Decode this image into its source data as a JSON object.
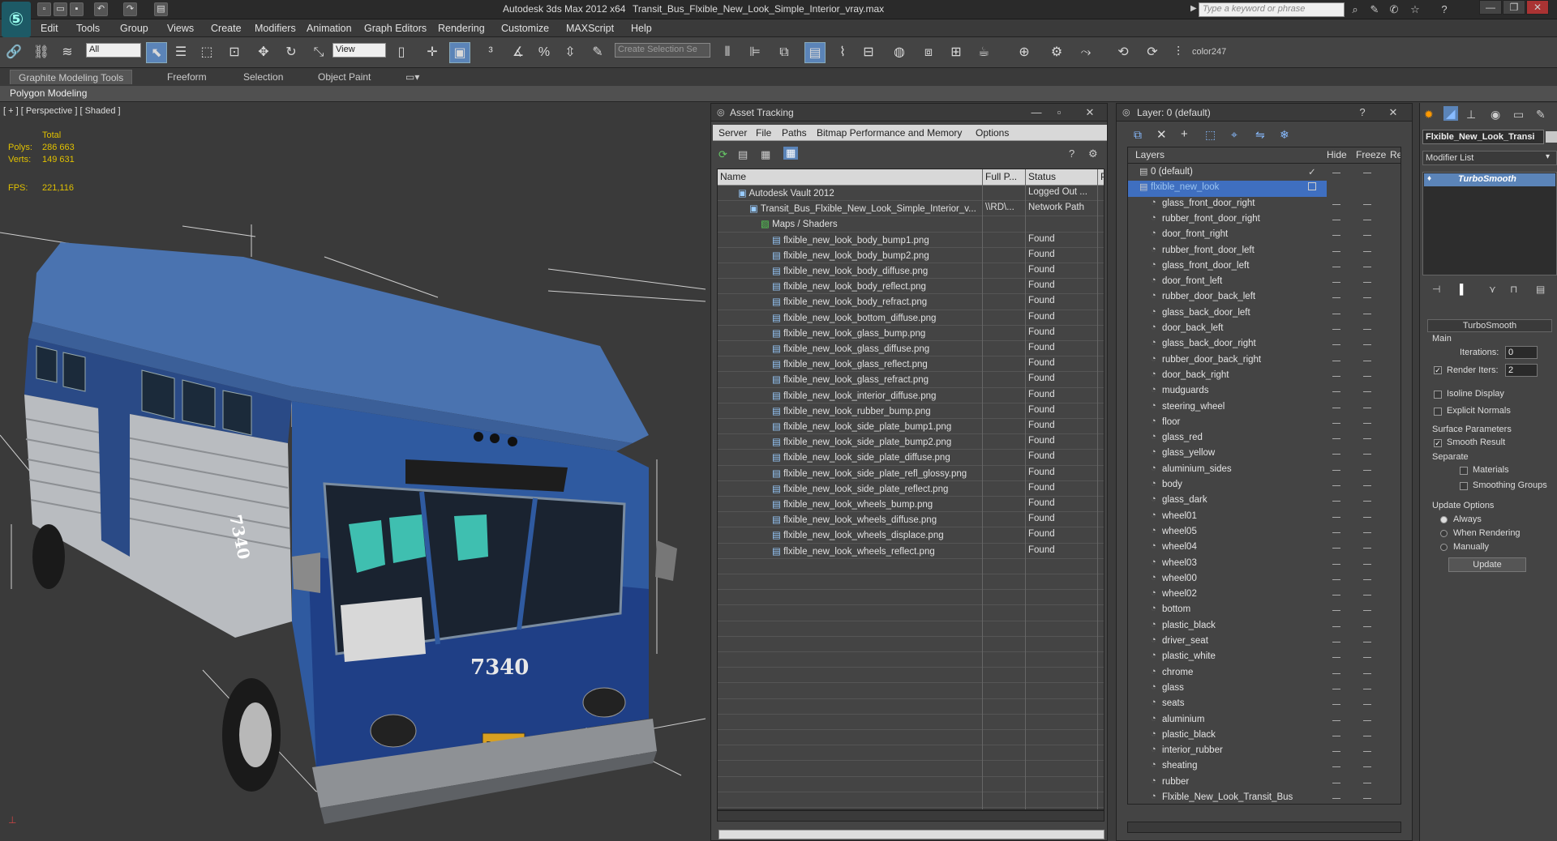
{
  "window": {
    "app_title": "Autodesk 3ds Max  2012 x64",
    "doc_title": "Transit_Bus_Flxible_New_Look_Simple_Interior_vray.max",
    "search_placeholder": "Type a keyword or phrase"
  },
  "menu": [
    "Edit",
    "Tools",
    "Group",
    "Views",
    "Create",
    "Modifiers",
    "Animation",
    "Graph Editors",
    "Rendering",
    "Customize",
    "MAXScript",
    "Help"
  ],
  "toolbar": {
    "selection_filter": "All",
    "ref_coord": "View",
    "named_selection": "Create Selection Se",
    "color_label": "color247"
  },
  "ribbon": {
    "tabs": [
      "Graphite Modeling Tools",
      "Freeform",
      "Selection",
      "Object Paint"
    ],
    "sub": "Polygon Modeling"
  },
  "viewport": {
    "label": "[ + ] [ Perspective ] [ Shaded ]",
    "total_label": "Total",
    "polys_label": "Polys:",
    "polys_value": "286 663",
    "verts_label": "Verts:",
    "verts_value": "149 631",
    "fps_label": "FPS:",
    "fps_value": "221,116",
    "bus_number": "7340",
    "plate": "BL-1590"
  },
  "asset_tracking": {
    "title": "Asset Tracking",
    "menu": [
      "Server",
      "File",
      "Paths",
      "Bitmap Performance and Memory",
      "Options"
    ],
    "columns": [
      "Name",
      "Full P...",
      "Status",
      "P"
    ],
    "rows": [
      {
        "name": "Autodesk Vault 2012",
        "path": "",
        "status": "Logged Out ...",
        "indent": 0
      },
      {
        "name": "Transit_Bus_Flxible_New_Look_Simple_Interior_v...",
        "path": "\\\\RD\\...",
        "status": "Network Path",
        "indent": 1
      },
      {
        "name": "Maps / Shaders",
        "path": "",
        "status": "",
        "indent": 2
      },
      {
        "name": "flxible_new_look_body_bump1.png",
        "path": "",
        "status": "Found",
        "indent": 3
      },
      {
        "name": "flxible_new_look_body_bump2.png",
        "path": "",
        "status": "Found",
        "indent": 3
      },
      {
        "name": "flxible_new_look_body_diffuse.png",
        "path": "",
        "status": "Found",
        "indent": 3
      },
      {
        "name": "flxible_new_look_body_reflect.png",
        "path": "",
        "status": "Found",
        "indent": 3
      },
      {
        "name": "flxible_new_look_body_refract.png",
        "path": "",
        "status": "Found",
        "indent": 3
      },
      {
        "name": "flxible_new_look_bottom_diffuse.png",
        "path": "",
        "status": "Found",
        "indent": 3
      },
      {
        "name": "flxible_new_look_glass_bump.png",
        "path": "",
        "status": "Found",
        "indent": 3
      },
      {
        "name": "flxible_new_look_glass_diffuse.png",
        "path": "",
        "status": "Found",
        "indent": 3
      },
      {
        "name": "flxible_new_look_glass_reflect.png",
        "path": "",
        "status": "Found",
        "indent": 3
      },
      {
        "name": "flxible_new_look_glass_refract.png",
        "path": "",
        "status": "Found",
        "indent": 3
      },
      {
        "name": "flxible_new_look_interior_diffuse.png",
        "path": "",
        "status": "Found",
        "indent": 3
      },
      {
        "name": "flxible_new_look_rubber_bump.png",
        "path": "",
        "status": "Found",
        "indent": 3
      },
      {
        "name": "flxible_new_look_side_plate_bump1.png",
        "path": "",
        "status": "Found",
        "indent": 3
      },
      {
        "name": "flxible_new_look_side_plate_bump2.png",
        "path": "",
        "status": "Found",
        "indent": 3
      },
      {
        "name": "flxible_new_look_side_plate_diffuse.png",
        "path": "",
        "status": "Found",
        "indent": 3
      },
      {
        "name": "flxible_new_look_side_plate_refl_glossy.png",
        "path": "",
        "status": "Found",
        "indent": 3
      },
      {
        "name": "flxible_new_look_side_plate_reflect.png",
        "path": "",
        "status": "Found",
        "indent": 3
      },
      {
        "name": "flxible_new_look_wheels_bump.png",
        "path": "",
        "status": "Found",
        "indent": 3
      },
      {
        "name": "flxible_new_look_wheels_diffuse.png",
        "path": "",
        "status": "Found",
        "indent": 3
      },
      {
        "name": "flxible_new_look_wheels_displace.png",
        "path": "",
        "status": "Found",
        "indent": 3
      },
      {
        "name": "flxible_new_look_wheels_reflect.png",
        "path": "",
        "status": "Found",
        "indent": 3
      }
    ]
  },
  "layers": {
    "title": "Layer: 0 (default)",
    "columns": [
      "Layers",
      "Hide",
      "Freeze",
      "Re"
    ],
    "rows": [
      "0 (default)",
      "flxible_new_look",
      "glass_front_door_right",
      "rubber_front_door_right",
      "door_front_right",
      "rubber_front_door_left",
      "glass_front_door_left",
      "door_front_left",
      "rubber_door_back_left",
      "glass_back_door_left",
      "door_back_left",
      "glass_back_door_right",
      "rubber_door_back_right",
      "door_back_right",
      "mudguards",
      "steering_wheel",
      "floor",
      "glass_red",
      "glass_yellow",
      "aluminium_sides",
      "body",
      "glass_dark",
      "wheel01",
      "wheel05",
      "wheel04",
      "wheel03",
      "wheel00",
      "wheel02",
      "bottom",
      "plastic_black",
      "driver_seat",
      "plastic_white",
      "chrome",
      "glass",
      "seats",
      "aluminium",
      "plastic_black",
      "interior_rubber",
      "sheating",
      "rubber",
      "Flxible_New_Look_Transit_Bus"
    ]
  },
  "command_panel": {
    "object_name": "Flxible_New_Look_Transi",
    "modifier_list": "Modifier List",
    "stack_item": "TurboSmooth",
    "rollout_title": "TurboSmooth",
    "main": "Main",
    "iterations_label": "Iterations:",
    "iterations_value": "0",
    "render_iters_label": "Render Iters:",
    "render_iters_value": "2",
    "isoline": "Isoline Display",
    "explicit": "Explicit Normals",
    "surface_params": "Surface Parameters",
    "smooth_result": "Smooth Result",
    "separate": "Separate",
    "materials": "Materials",
    "smoothing_groups": "Smoothing Groups",
    "update_options": "Update Options",
    "always": "Always",
    "when_rendering": "When Rendering",
    "manually": "Manually",
    "update_btn": "Update"
  }
}
